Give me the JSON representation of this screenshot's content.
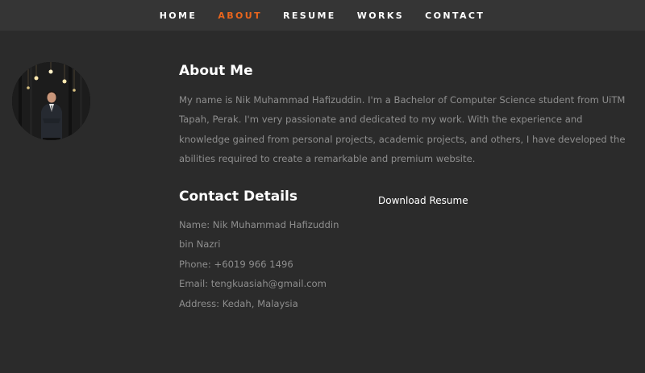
{
  "nav": {
    "items": [
      {
        "label": "HOME",
        "active": false
      },
      {
        "label": "ABOUT",
        "active": true
      },
      {
        "label": "RESUME",
        "active": false
      },
      {
        "label": "WORKS",
        "active": false
      },
      {
        "label": "CONTACT",
        "active": false
      }
    ],
    "accent_color": "#e8651d"
  },
  "about": {
    "title": "About Me",
    "text": "My name is Nik Muhammad Hafizuddin. I'm a Bachelor of Computer Science student from UiTM Tapah, Perak. I'm very passionate and dedicated to my work. With the experience and knowledge gained from personal projects, academic projects, and others, I have developed the abilities required to create a remarkable and premium website."
  },
  "contact": {
    "title": "Contact Details",
    "name": "Name: Nik Muhammad Hafizuddin bin Nazri",
    "phone": "Phone: +6019 966 1496",
    "email": "Email: tengkuasiah@gmail.com",
    "address": "Address: Kedah, Malaysia"
  },
  "resume": {
    "download_label": "Download Resume"
  },
  "colors": {
    "background": "#2b2b2b",
    "navbar": "#353535",
    "body_text": "#8e8e8e",
    "heading": "#ffffff"
  }
}
